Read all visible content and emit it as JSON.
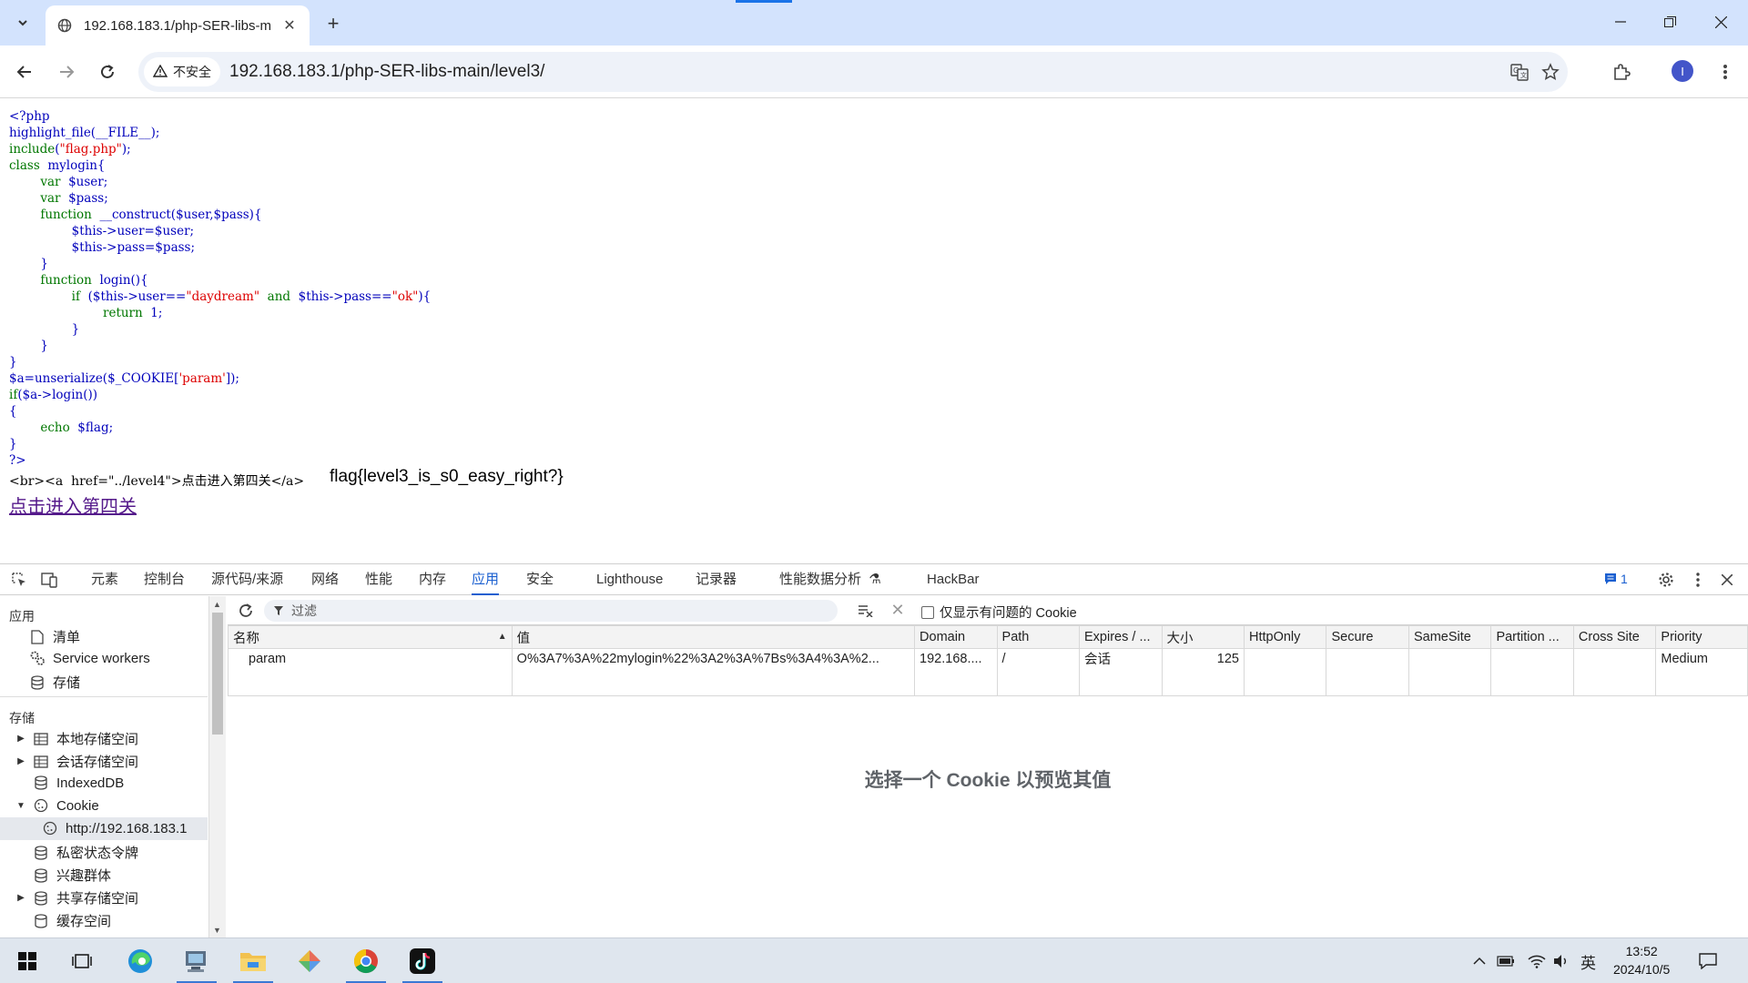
{
  "browser": {
    "tab_title": "192.168.183.1/php-SER-libs-m",
    "security_label": "不安全",
    "url": "192.168.183.1/php-SER-libs-main/level3/",
    "profile_initial": "I"
  },
  "page": {
    "code_lines": [
      "<?php",
      "highlight_file(__FILE__);",
      "include(\"flag.php\");",
      "class  mylogin{",
      "        var  $user;",
      "        var  $pass;",
      "        function  __construct($user,$pass){",
      "                $this->user=$user;",
      "                $this->pass=$pass;",
      "        }",
      "        function  login(){",
      "                if  ($this->user==\"daydream\"  and  $this->pass==\"ok\"){",
      "                        return  1;",
      "                }",
      "        }",
      "}",
      "$a=unserialize($_COOKIE['param']);",
      "if($a->login())",
      "{",
      "        echo  $flag;",
      "}",
      "?>"
    ],
    "raw_html_text": "<br><a  href=\"../level4\">点击进入第四关</a>",
    "flag_text": "flag{level3_is_s0_easy_right?}",
    "link_text": "点击进入第四关"
  },
  "devtools": {
    "tabs": [
      "元素",
      "控制台",
      "源代码/来源",
      "网络",
      "性能",
      "内存",
      "应用",
      "安全",
      "Lighthouse",
      "记录器",
      "性能数据分析",
      "HackBar"
    ],
    "active_tab": "应用",
    "message_count": "1",
    "sidebar": {
      "section_app": "应用",
      "app_items": [
        "清单",
        "Service workers",
        "存储"
      ],
      "section_storage": "存储",
      "storage_items": [
        "本地存储空间",
        "会话存储空间",
        "IndexedDB",
        "Cookie",
        "http://192.168.183.1",
        "私密状态令牌",
        "兴趣群体",
        "共享存储空间",
        "缓存空间"
      ]
    },
    "filter_placeholder": "过滤",
    "only_issues_label": "仅显示有问题的 Cookie",
    "columns": [
      "名称",
      "值",
      "Domain",
      "Path",
      "Expires / ...",
      "大小",
      "HttpOnly",
      "Secure",
      "SameSite",
      "Partition ...",
      "Cross Site",
      "Priority"
    ],
    "rows": [
      {
        "name": "param",
        "value": "O%3A7%3A%22mylogin%22%3A2%3A%7Bs%3A4%3A%2...",
        "domain": "192.168....",
        "path": "/",
        "expires": "会话",
        "size": "125",
        "httponly": "",
        "secure": "",
        "samesite": "",
        "partition": "",
        "crosssite": "",
        "priority": "Medium"
      }
    ],
    "preview_hint": "选择一个 Cookie 以预览其值"
  },
  "taskbar": {
    "ime_label": "英",
    "time": "13:52",
    "date": "2024/10/5"
  }
}
